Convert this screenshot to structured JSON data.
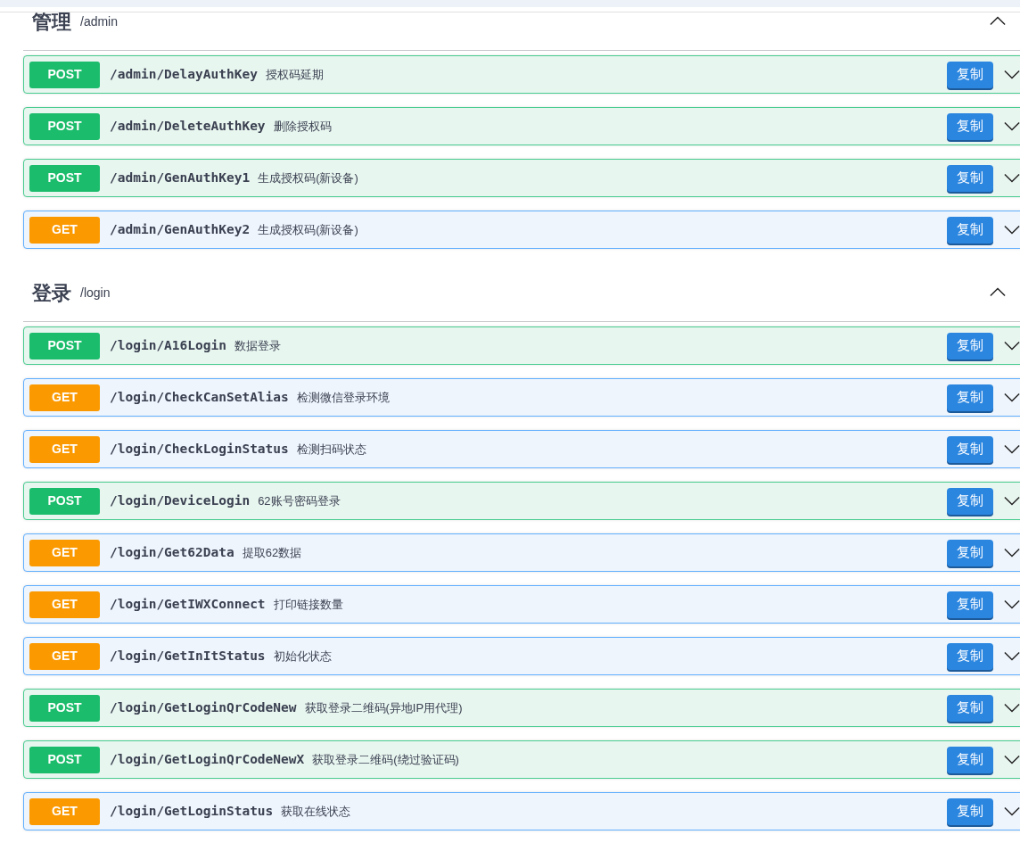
{
  "sections": [
    {
      "title": "管理",
      "path": "/admin",
      "expanded": true,
      "endpoints": [
        {
          "kind": "post",
          "method": "POST",
          "path": "/admin/DelayAuthKey",
          "summary": "授权码延期",
          "copy": "复制",
          "expanded": false
        },
        {
          "kind": "post",
          "method": "POST",
          "path": "/admin/DeleteAuthKey",
          "summary": "删除授权码",
          "copy": "复制",
          "expanded": false
        },
        {
          "kind": "post",
          "method": "POST",
          "path": "/admin/GenAuthKey1",
          "summary": "生成授权码(新设备)",
          "copy": "复制",
          "expanded": false
        },
        {
          "kind": "get",
          "method": "GET",
          "path": "/admin/GenAuthKey2",
          "summary": "生成授权码(新设备)",
          "copy": "复制",
          "expanded": false
        }
      ]
    },
    {
      "title": "登录",
      "path": "/login",
      "expanded": true,
      "endpoints": [
        {
          "kind": "post",
          "method": "POST",
          "path": "/login/A16Login",
          "summary": "数据登录",
          "copy": "复制",
          "expanded": false
        },
        {
          "kind": "get",
          "method": "GET",
          "path": "/login/CheckCanSetAlias",
          "summary": "检测微信登录环境",
          "copy": "复制",
          "expanded": false
        },
        {
          "kind": "get",
          "method": "GET",
          "path": "/login/CheckLoginStatus",
          "summary": "检测扫码状态",
          "copy": "复制",
          "expanded": false
        },
        {
          "kind": "post",
          "method": "POST",
          "path": "/login/DeviceLogin",
          "summary": "62账号密码登录",
          "copy": "复制",
          "expanded": false
        },
        {
          "kind": "get",
          "method": "GET",
          "path": "/login/Get62Data",
          "summary": "提取62数据",
          "copy": "复制",
          "expanded": false
        },
        {
          "kind": "get",
          "method": "GET",
          "path": "/login/GetIWXConnect",
          "summary": "打印链接数量",
          "copy": "复制",
          "expanded": false
        },
        {
          "kind": "get",
          "method": "GET",
          "path": "/login/GetInItStatus",
          "summary": "初始化状态",
          "copy": "复制",
          "expanded": false
        },
        {
          "kind": "post",
          "method": "POST",
          "path": "/login/GetLoginQrCodeNew",
          "summary": "获取登录二维码(异地IP用代理)",
          "copy": "复制",
          "expanded": false
        },
        {
          "kind": "post",
          "method": "POST",
          "path": "/login/GetLoginQrCodeNewX",
          "summary": "获取登录二维码(绕过验证码)",
          "copy": "复制",
          "expanded": false
        },
        {
          "kind": "get",
          "method": "GET",
          "path": "/login/GetLoginStatus",
          "summary": "获取在线状态",
          "copy": "复制",
          "expanded": false
        }
      ]
    }
  ]
}
